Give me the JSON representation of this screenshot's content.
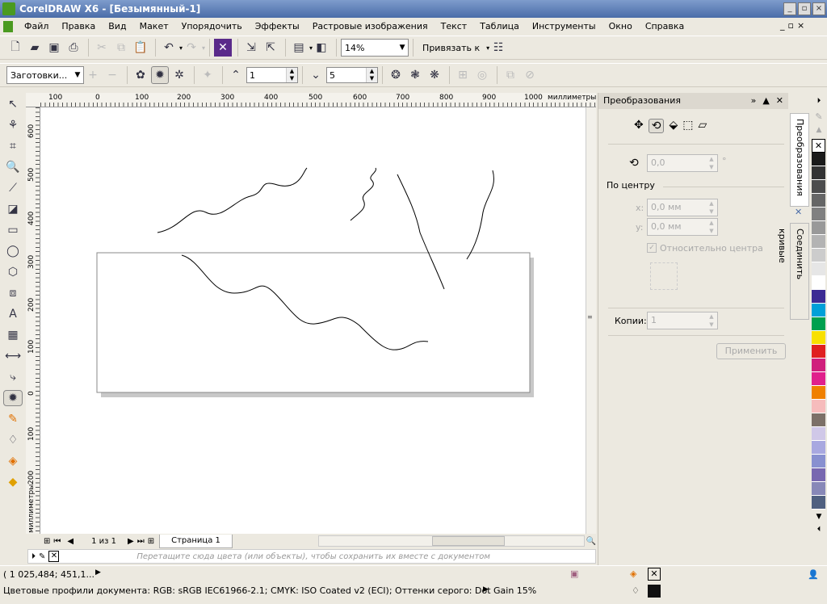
{
  "window": {
    "title": "CorelDRAW X6 - [Безымянный-1]",
    "controls": [
      "_",
      "▫",
      "×"
    ],
    "doc_controls": [
      "_",
      "▫",
      "×"
    ]
  },
  "menu": [
    "Файл",
    "Правка",
    "Вид",
    "Макет",
    "Упорядочить",
    "Эффекты",
    "Растровые изображения",
    "Текст",
    "Таблица",
    "Инструменты",
    "Окно",
    "Справка"
  ],
  "toolbar": {
    "zoom": "14%",
    "snap": "Привязать к"
  },
  "propbar": {
    "presets": "Заготовки...",
    "min_value": "1",
    "max_value": "5"
  },
  "rulers": {
    "unit": "миллиметры",
    "top_ticks": [
      "100",
      "0",
      "100",
      "200",
      "300",
      "400",
      "500",
      "600",
      "700",
      "800",
      "900",
      "1000"
    ],
    "left_ticks": [
      "600",
      "500",
      "400",
      "300",
      "200",
      "100",
      "0",
      "100",
      "200"
    ]
  },
  "pagenav": {
    "count": "1 из 1",
    "page_tab": "Страница 1"
  },
  "doc_palette": {
    "hint": "Перетащите сюда цвета (или объекты), чтобы сохранить их вместе с документом"
  },
  "docker": {
    "title": "Преобразования",
    "angle": "0,0",
    "angle_unit": "°",
    "center_label": "По центру",
    "x_label": "x:",
    "x": "0,0 мм",
    "y_label": "y:",
    "y": "0,0 мм",
    "relative": "Относительно центра",
    "relative_checked": true,
    "copies_label": "Копии:",
    "copies": "1",
    "apply": "Применить"
  },
  "side_tabs": [
    "Преобразования",
    "Соединить кривые"
  ],
  "palette": [
    "#ffffff",
    "#1a1a1a",
    "#333333",
    "#4d4d4d",
    "#666666",
    "#808080",
    "#999999",
    "#b3b3b3",
    "#cccccc",
    "#e6e6e6",
    "#ffffff",
    "#3c2b94",
    "#00a0d8",
    "#00a04e",
    "#f8e000",
    "#e02020",
    "#d0207c",
    "#e0208c",
    "#f08000",
    "#f6bcbc",
    "#7c7068",
    "#d0c8e8",
    "#a8a8e0",
    "#8890d0",
    "#7868b0",
    "#8888b8",
    "#506080"
  ],
  "status": {
    "coords": "( 1 025,484; 451,1...",
    "profiles": "Цветовые профили документа: RGB: sRGB IEC61966-2.1; CMYK: ISO Coated v2 (ECI); Оттенки серого: Dot Gain 15%"
  }
}
